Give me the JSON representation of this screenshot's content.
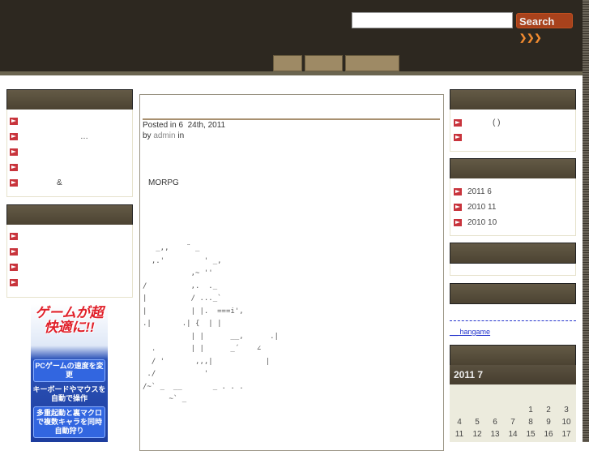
{
  "header": {
    "search_placeholder": "",
    "search_value": "",
    "search_label": "Search",
    "search_icon": "triple-chevron-right"
  },
  "nav": {
    "tabs": [
      "",
      "",
      ""
    ]
  },
  "left_sidebar": {
    "widget1": {
      "title": "",
      "items": [
        "",
        "…",
        "",
        "",
        "&"
      ]
    },
    "widget2": {
      "title": "",
      "items": [
        "",
        "",
        "",
        ""
      ]
    },
    "banner": {
      "headline": "ゲームが超快適に!!",
      "lines": [
        "PCゲームの速度を変更",
        "キーボードやマウスを自動で操作",
        "多重起動と裏マクロで複数キャラを同時自動狩り"
      ]
    }
  },
  "post": {
    "title": "",
    "posted": "Posted in 6  24th, 2011",
    "by": "by",
    "author": "admin",
    "in": "in",
    "body_text": "MORPG",
    "ascii_art": [
      "   _,,    ¨ _",
      "  ,.'         ' _,",
      "           ,~ ''",
      "/          ,.  ._",
      "|          / ..._`",
      "|          | |.  ===i',",
      ".|       .| {  | |",
      "           | |      __,      .|",
      "  .        | |      _´    ∠",
      "  / '       ,,,|            |",
      " ./           '",
      "/~` _  __       _ . . .",
      "      ~` _"
    ]
  },
  "right_sidebar": {
    "widget1": {
      "title": "",
      "items": [
        "(        )",
        ""
      ]
    },
    "archives": {
      "title": "",
      "items": [
        "2011  6",
        "2010  11",
        "2010  10"
      ]
    },
    "widget3": {
      "title": ""
    },
    "links": {
      "title": "",
      "items": [
        "",
        "hangame"
      ]
    },
    "calendar": {
      "title": "",
      "caption": "2011  7",
      "days": [
        "1",
        "2",
        "3",
        "4",
        "5",
        "6",
        "7",
        "8",
        "9",
        "10",
        "11",
        "12",
        "13",
        "14",
        "15",
        "16",
        "17"
      ]
    }
  },
  "colors": {
    "header_bg": "#2d2820",
    "widget_header": "#564c3a",
    "nav_tab": "#9e8a65",
    "bullet": "#c8343c",
    "search_button": "#a8421c",
    "calendar_bg": "#ecebdd"
  }
}
